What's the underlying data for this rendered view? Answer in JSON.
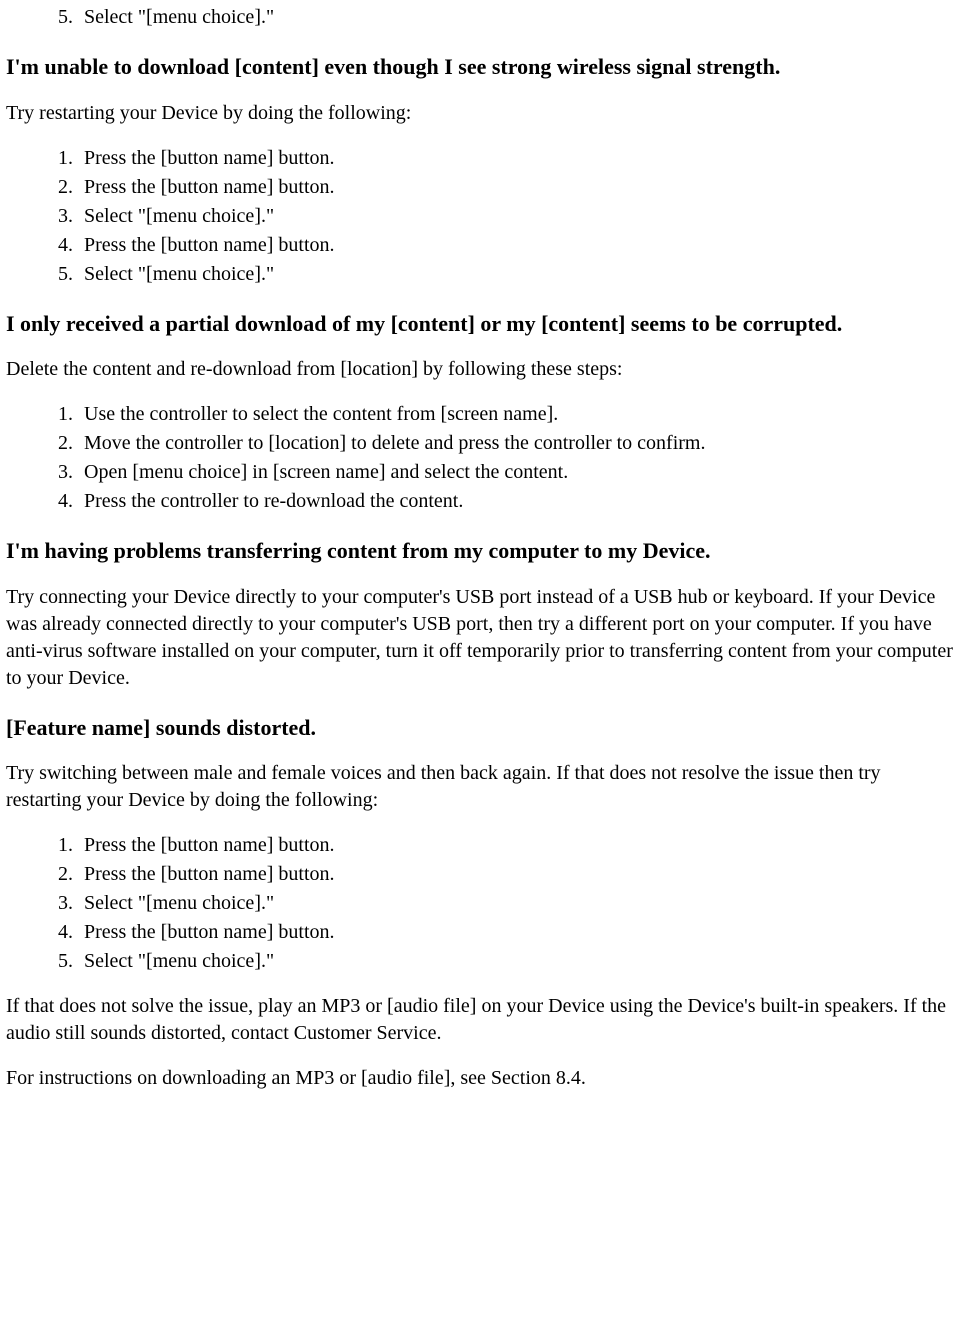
{
  "top_list": {
    "start": 5,
    "items": [
      "Select \"[menu choice].\""
    ]
  },
  "sections": [
    {
      "heading": "I'm unable to download [content] even though I see strong wireless signal strength.",
      "intro": "Try restarting your Device by doing the following:",
      "list": [
        "Press the [button name] button.",
        "Press the [button name] button.",
        "Select \"[menu choice].\"",
        "Press the [button name] button.",
        "Select \"[menu choice].\""
      ]
    },
    {
      "heading": "I only received a partial download of my [content] or my [content] seems to be corrupted.",
      "intro": "Delete the content and re-download from [location] by following these steps:",
      "list": [
        "Use the controller to select the content from [screen name].",
        "Move the controller to [location] to delete and press the controller to confirm.",
        "Open [menu choice] in [screen name] and select the content.",
        "Press the controller to re-download the content."
      ]
    },
    {
      "heading": "I'm having problems transferring content from my computer to my Device.",
      "intro": "Try connecting your Device directly to your computer's USB port instead of a USB hub or keyboard. If your Device was already connected directly to your computer's USB port, then try a different port on your computer. If you have anti-virus software installed on your computer, turn it off temporarily prior to transferring content from your computer to your Device."
    },
    {
      "heading": "[Feature name] sounds distorted.",
      "intro": "Try switching between male and female voices and then back again. If that does not resolve the issue then try restarting your Device by doing the following:",
      "list": [
        "Press the [button name] button.",
        "Press the [button name] button.",
        "Select \"[menu choice].\"",
        "Press the [button name] button.",
        "Select \"[menu choice].\""
      ],
      "after": [
        "If that does not solve the issue, play an MP3 or [audio file] on your Device using the Device's built-in speakers. If the audio still sounds distorted, contact Customer Service.",
        "For instructions on downloading an MP3 or [audio file], see Section 8.4."
      ]
    }
  ]
}
